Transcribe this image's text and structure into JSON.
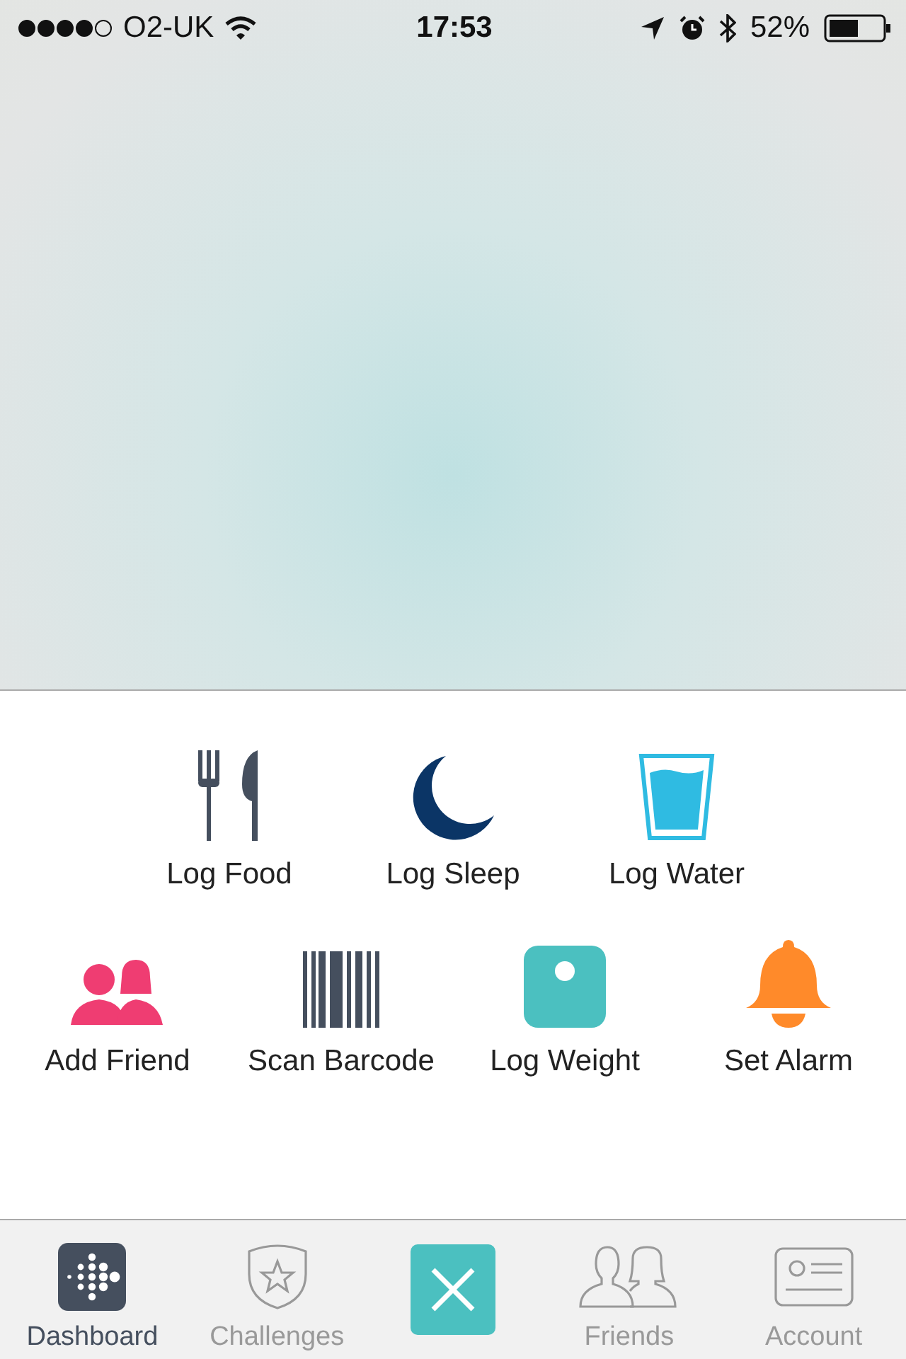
{
  "status_bar": {
    "carrier": "O2-UK",
    "time": "17:53",
    "battery": "52%"
  },
  "actions": [
    [
      {
        "label": "Log Food",
        "kind": "food"
      },
      {
        "label": "Log Sleep",
        "kind": "sleep"
      },
      {
        "label": "Log Water",
        "kind": "water"
      }
    ],
    [
      {
        "label": "Add Friend",
        "kind": "friend"
      },
      {
        "label": "Scan Barcode",
        "kind": "barcode"
      },
      {
        "label": "Log Weight",
        "kind": "weight"
      },
      {
        "label": "Set Alarm",
        "kind": "alarm"
      }
    ]
  ],
  "tab_bar": [
    {
      "label": "Dashboard",
      "kind": "dashboard",
      "selected": true
    },
    {
      "label": "Challenges",
      "kind": "challenges",
      "selected": false
    },
    {
      "kind": "close"
    },
    {
      "label": "Friends",
      "kind": "friends",
      "selected": false
    },
    {
      "label": "Account",
      "kind": "account",
      "selected": false
    }
  ]
}
